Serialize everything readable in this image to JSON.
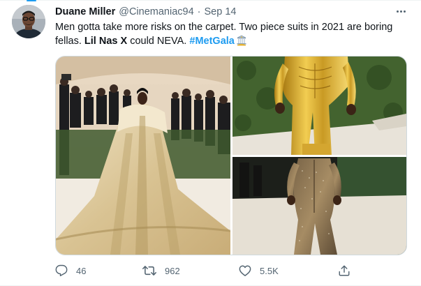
{
  "tweet": {
    "author_name": "Duane Miller",
    "handle": "@Cinemaniac94",
    "separator": "·",
    "date": "Sep 14",
    "text_part1": "Men gotta take more risks on the carpet. Two piece suits in 2021 are boring fellas. ",
    "mention": "Lil Nas X",
    "text_part2": " could NEVA. ",
    "hashtag": "#MetGala"
  },
  "media": {
    "photos": [
      {
        "subject": "man in gold embroidered cape gown on carpet"
      },
      {
        "subject": "gold armor suit"
      },
      {
        "subject": "crystal studded bodysuit"
      }
    ]
  },
  "actions": {
    "reply_count": "46",
    "retweet_count": "962",
    "like_count": "5.5K",
    "icons": [
      "reply-icon",
      "retweet-icon",
      "like-icon",
      "share-icon"
    ]
  },
  "colors": {
    "accent": "#1d9bf0",
    "text_primary": "#0f1419",
    "text_secondary": "#536471",
    "border": "#cfd9de"
  }
}
